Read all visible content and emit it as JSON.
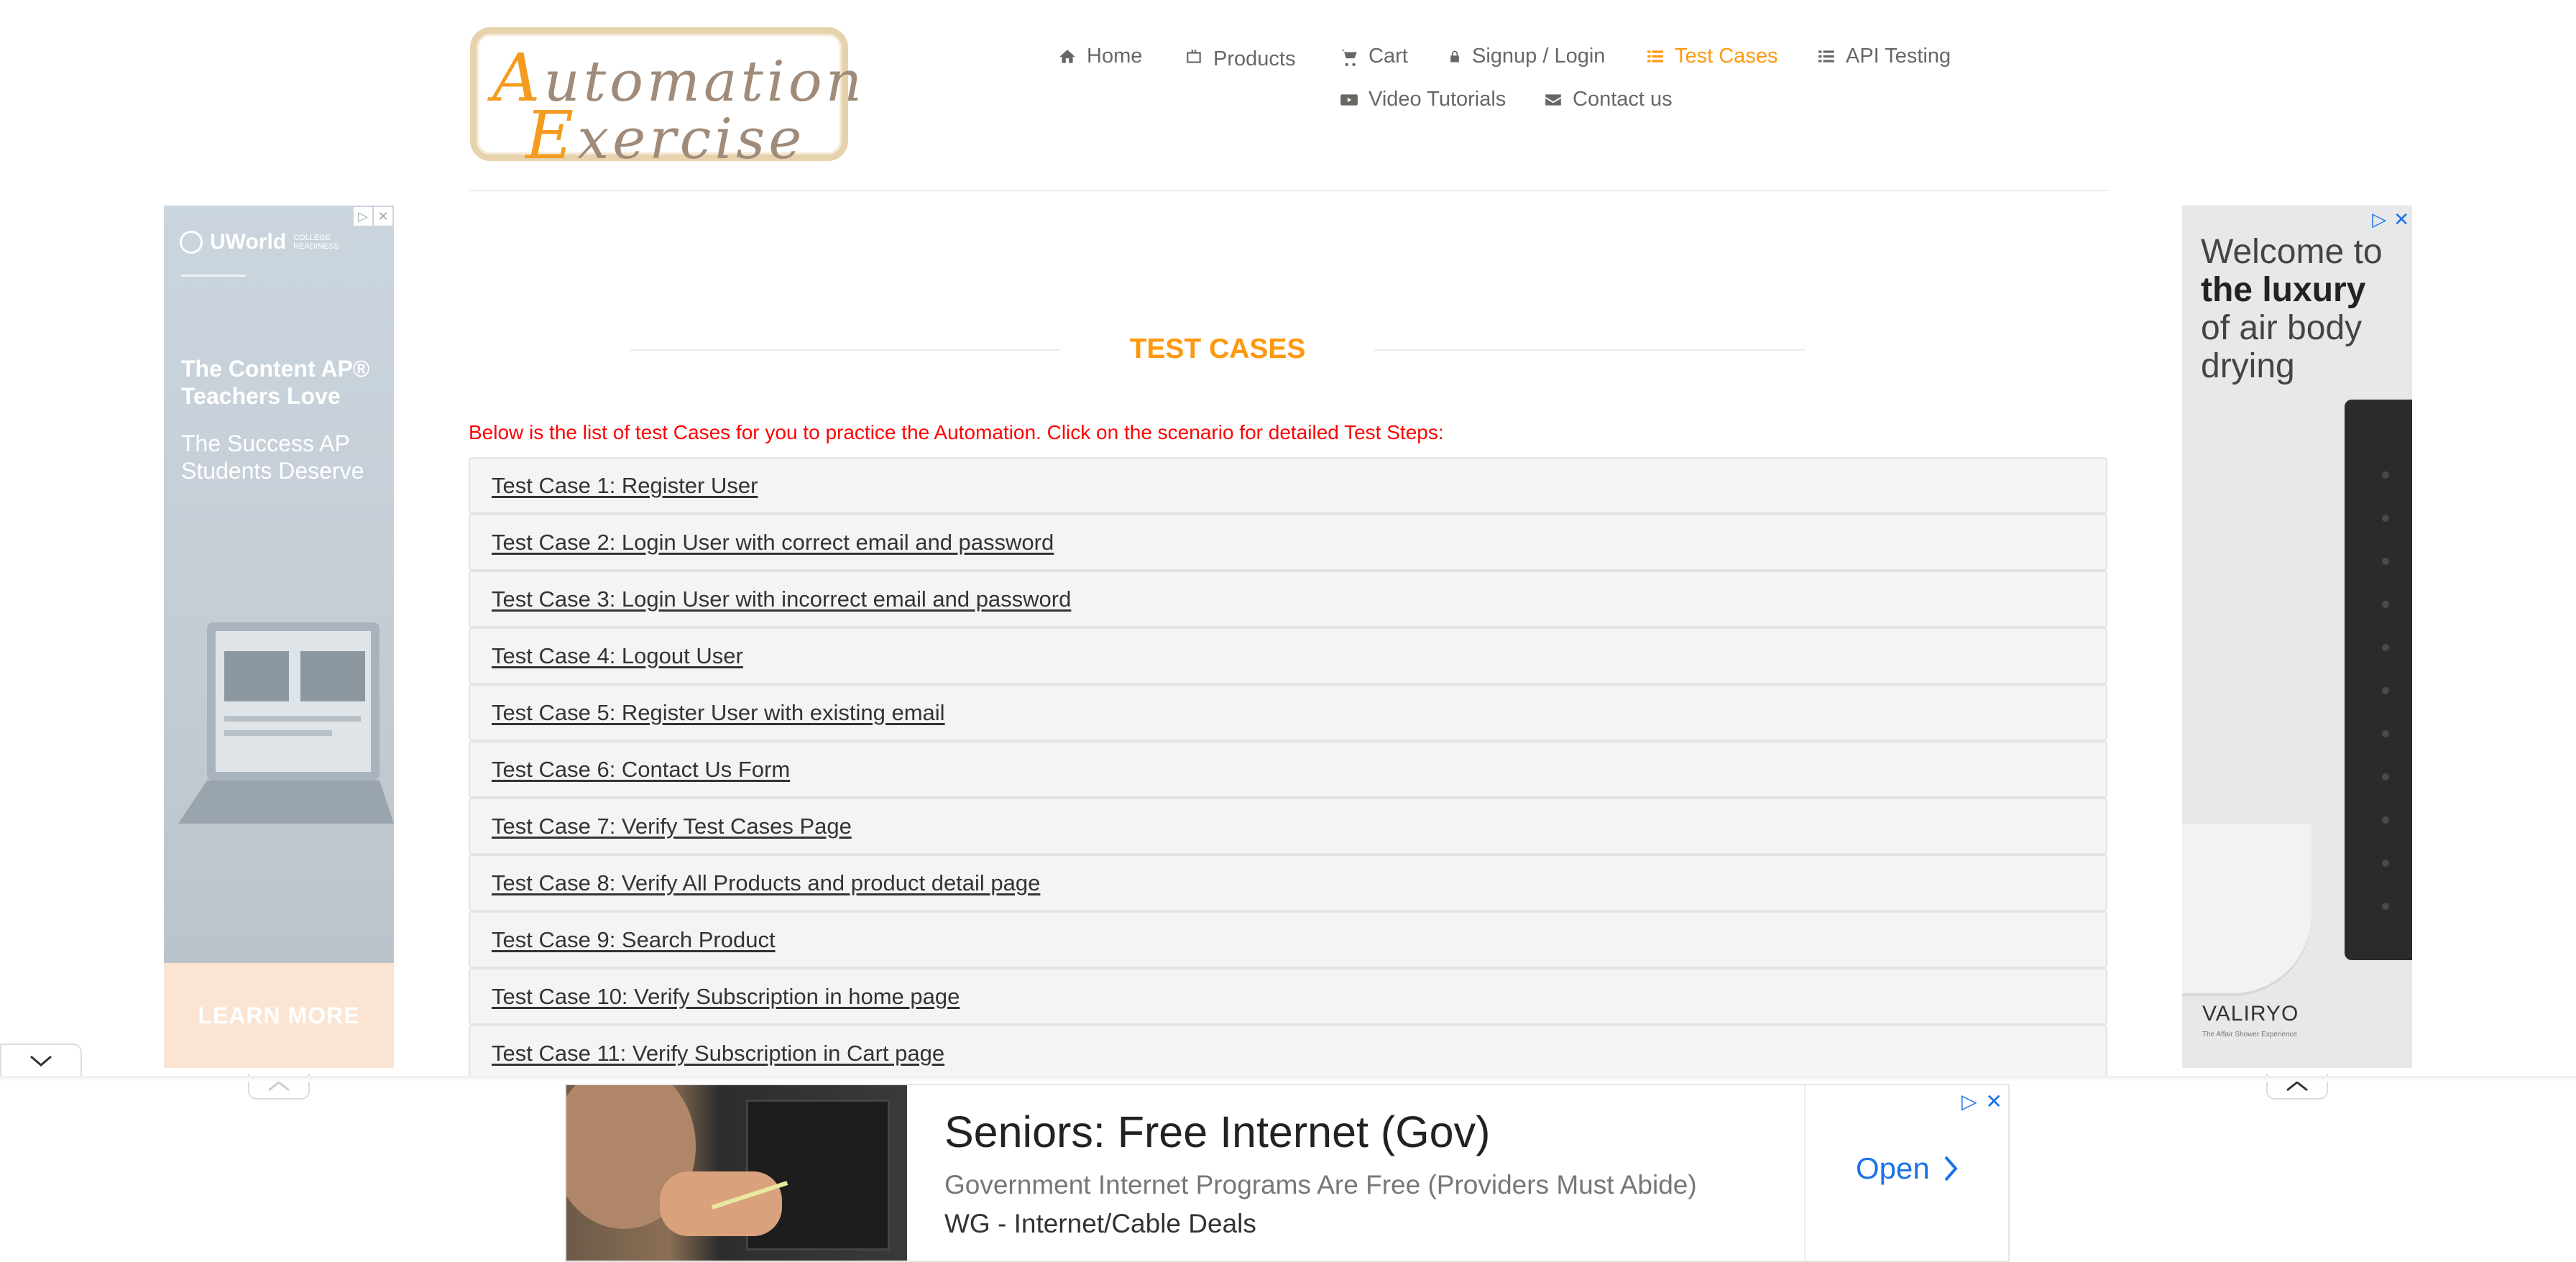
{
  "logo": {
    "line1_cap": "A",
    "line1_rest": "utomation",
    "line2_cap": "E",
    "line2_rest": "xercise"
  },
  "nav": [
    {
      "label": "Home",
      "icon": "home-icon"
    },
    {
      "label": "Products",
      "icon": "products-icon"
    },
    {
      "label": "Cart",
      "icon": "cart-icon"
    },
    {
      "label": "Signup / Login",
      "icon": "lock-icon"
    },
    {
      "label": "Test Cases",
      "icon": "list-icon",
      "active": true
    },
    {
      "label": "API Testing",
      "icon": "list-icon"
    },
    {
      "label": "Video Tutorials",
      "icon": "youtube-icon"
    },
    {
      "label": "Contact us",
      "icon": "envelope-icon"
    }
  ],
  "main": {
    "title": "TEST CASES",
    "intro": "Below is the list of test Cases for you to practice the Automation. Click on the scenario for detailed Test Steps:",
    "test_cases": [
      "Test Case 1: Register User",
      "Test Case 2: Login User with correct email and password",
      "Test Case 3: Login User with incorrect email and password",
      "Test Case 4: Logout User",
      "Test Case 5: Register User with existing email",
      "Test Case 6: Contact Us Form",
      "Test Case 7: Verify Test Cases Page",
      "Test Case 8: Verify All Products and product detail page",
      "Test Case 9: Search Product",
      "Test Case 10: Verify Subscription in home page",
      "Test Case 11: Verify Subscription in Cart page"
    ]
  },
  "ads": {
    "left": {
      "brand": "UWorld",
      "brand_sub": "COLLEGE READINESS",
      "headline": "The Content AP® Teachers Love",
      "subline": "The Success AP Students Deserve",
      "cta": "LEARN MORE"
    },
    "right": {
      "line1": "Welcome to",
      "line2": "the luxury",
      "line3": "of air body drying",
      "brand": "VALIRYO",
      "tagline": "The Affair Shower Experience"
    },
    "bottom": {
      "headline": "Seniors: Free Internet (Gov)",
      "subtitle": "Government Internet Programs Are Free (Providers Must Abide)",
      "source": "WG - Internet/Cable Deals",
      "cta": "Open"
    }
  },
  "colors": {
    "accent": "#fe980f",
    "intro_red": "#fe0000",
    "ad_blue": "#1a73e8"
  }
}
